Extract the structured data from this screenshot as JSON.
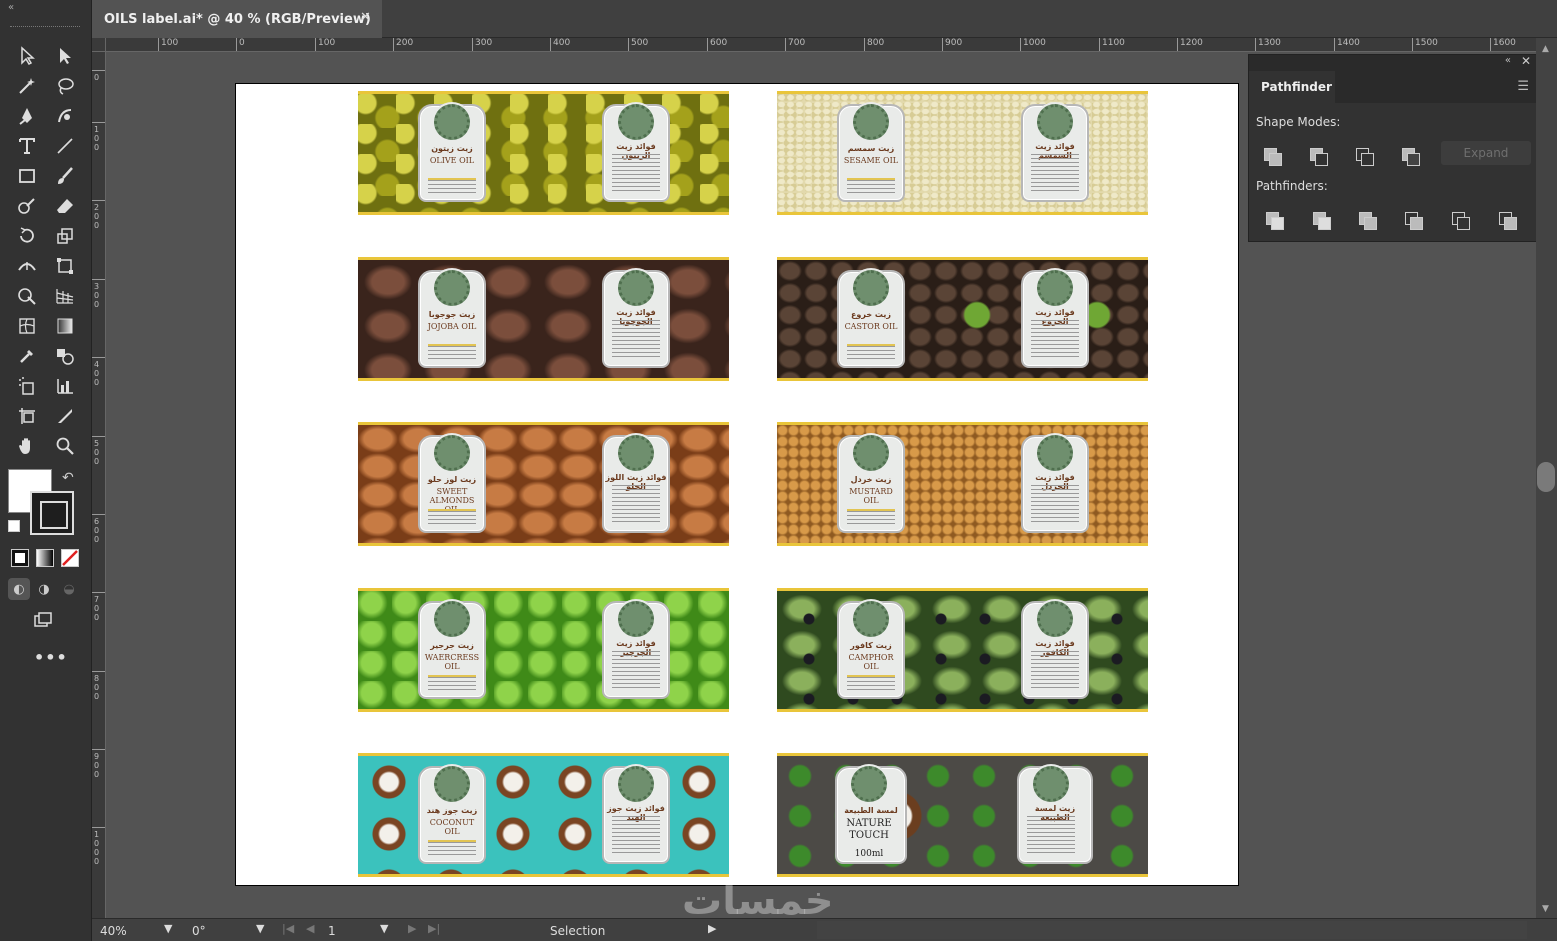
{
  "window": {
    "tab_title": "OILS label.ai* @ 40 % (RGB/Preview)",
    "tab_close": "✕"
  },
  "rulers": {
    "horizontal": [
      "100",
      "0",
      "100",
      "200",
      "300",
      "400",
      "500",
      "600",
      "700",
      "800",
      "900",
      "1000",
      "1100",
      "1200",
      "1300",
      "1400",
      "1500",
      "1600"
    ],
    "vertical": [
      "0",
      "100",
      "200",
      "300",
      "400",
      "500",
      "600",
      "700",
      "800",
      "900",
      "1000"
    ]
  },
  "labels": [
    {
      "front_ar": "زيت زيتون",
      "front_en": "OLIVE OIL",
      "back_ar": "فوائد زيت الزيتون"
    },
    {
      "front_ar": "زيت سمسم",
      "front_en": "SESAME OIL",
      "back_ar": "فوائد زيت السمسم"
    },
    {
      "front_ar": "زيت جوجوبا",
      "front_en": "JOJOBA OIL",
      "back_ar": "فوائد زيت الجوجوبا"
    },
    {
      "front_ar": "زيت خروع",
      "front_en": "CASTOR OIL",
      "back_ar": "فوائد زيت الخروع"
    },
    {
      "front_ar": "زيت لوز حلو",
      "front_en": "SWEET ALMONDS OIL",
      "back_ar": "فوائد زيت اللوز الحلو"
    },
    {
      "front_ar": "زيت خردل",
      "front_en": "MUSTARD OIL",
      "back_ar": "فوائد زيت الخردل"
    },
    {
      "front_ar": "زيت جرجير",
      "front_en": "WAERCRESS OIL",
      "back_ar": "فوائد زيت الجرجير"
    },
    {
      "front_ar": "زيت كافور",
      "front_en": "CAMPHOR OIL",
      "back_ar": "فوائد زيت الكافور"
    },
    {
      "front_ar": "زيت جوز هند",
      "front_en": "COCONUT OIL",
      "back_ar": "فوائد زيت جوز الهند"
    },
    {
      "front_ar": "لمسة الطبيعة",
      "front_en": "NATURE TOUCH",
      "back_ar": "زيت لمسة الطبيعة",
      "extra": "100ml"
    }
  ],
  "pathfinder": {
    "tab": "Pathfinder",
    "shape_modes": "Shape Modes:",
    "pathfinders": "Pathfinders:",
    "expand": "Expand"
  },
  "status": {
    "zoom": "40%",
    "rotation": "0°",
    "artboard": "1",
    "tool": "Selection"
  },
  "watermark": "خمسات"
}
